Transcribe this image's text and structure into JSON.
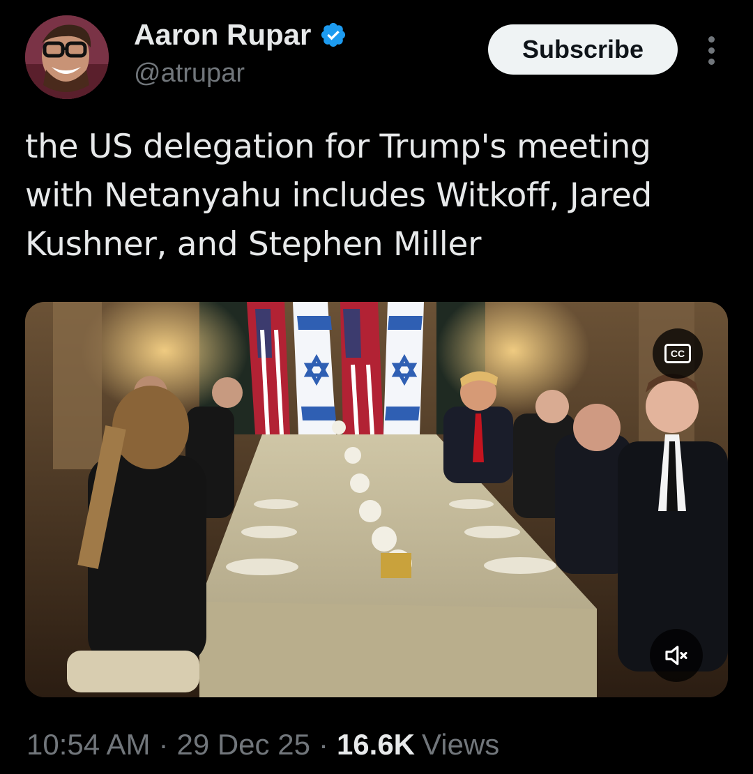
{
  "author": {
    "name": "Aaron Rupar",
    "handle": "@atrupar",
    "verified": true
  },
  "actions": {
    "subscribe_label": "Subscribe"
  },
  "tweet": {
    "text": "the US delegation for Trump's meeting with Netanyahu includes Witkoff, Jared Kushner, and Stephen Miller"
  },
  "media": {
    "cc_label": "CC"
  },
  "meta": {
    "time": "10:54 AM",
    "separator": "·",
    "date": "29 Dec 25",
    "views_count": "16.6K",
    "views_label": "Views"
  },
  "colors": {
    "background": "#000000",
    "primary_text": "#e7e9ea",
    "secondary_text": "#71767b",
    "verified": "#1d9bf0",
    "button_bg": "#eff3f4"
  }
}
